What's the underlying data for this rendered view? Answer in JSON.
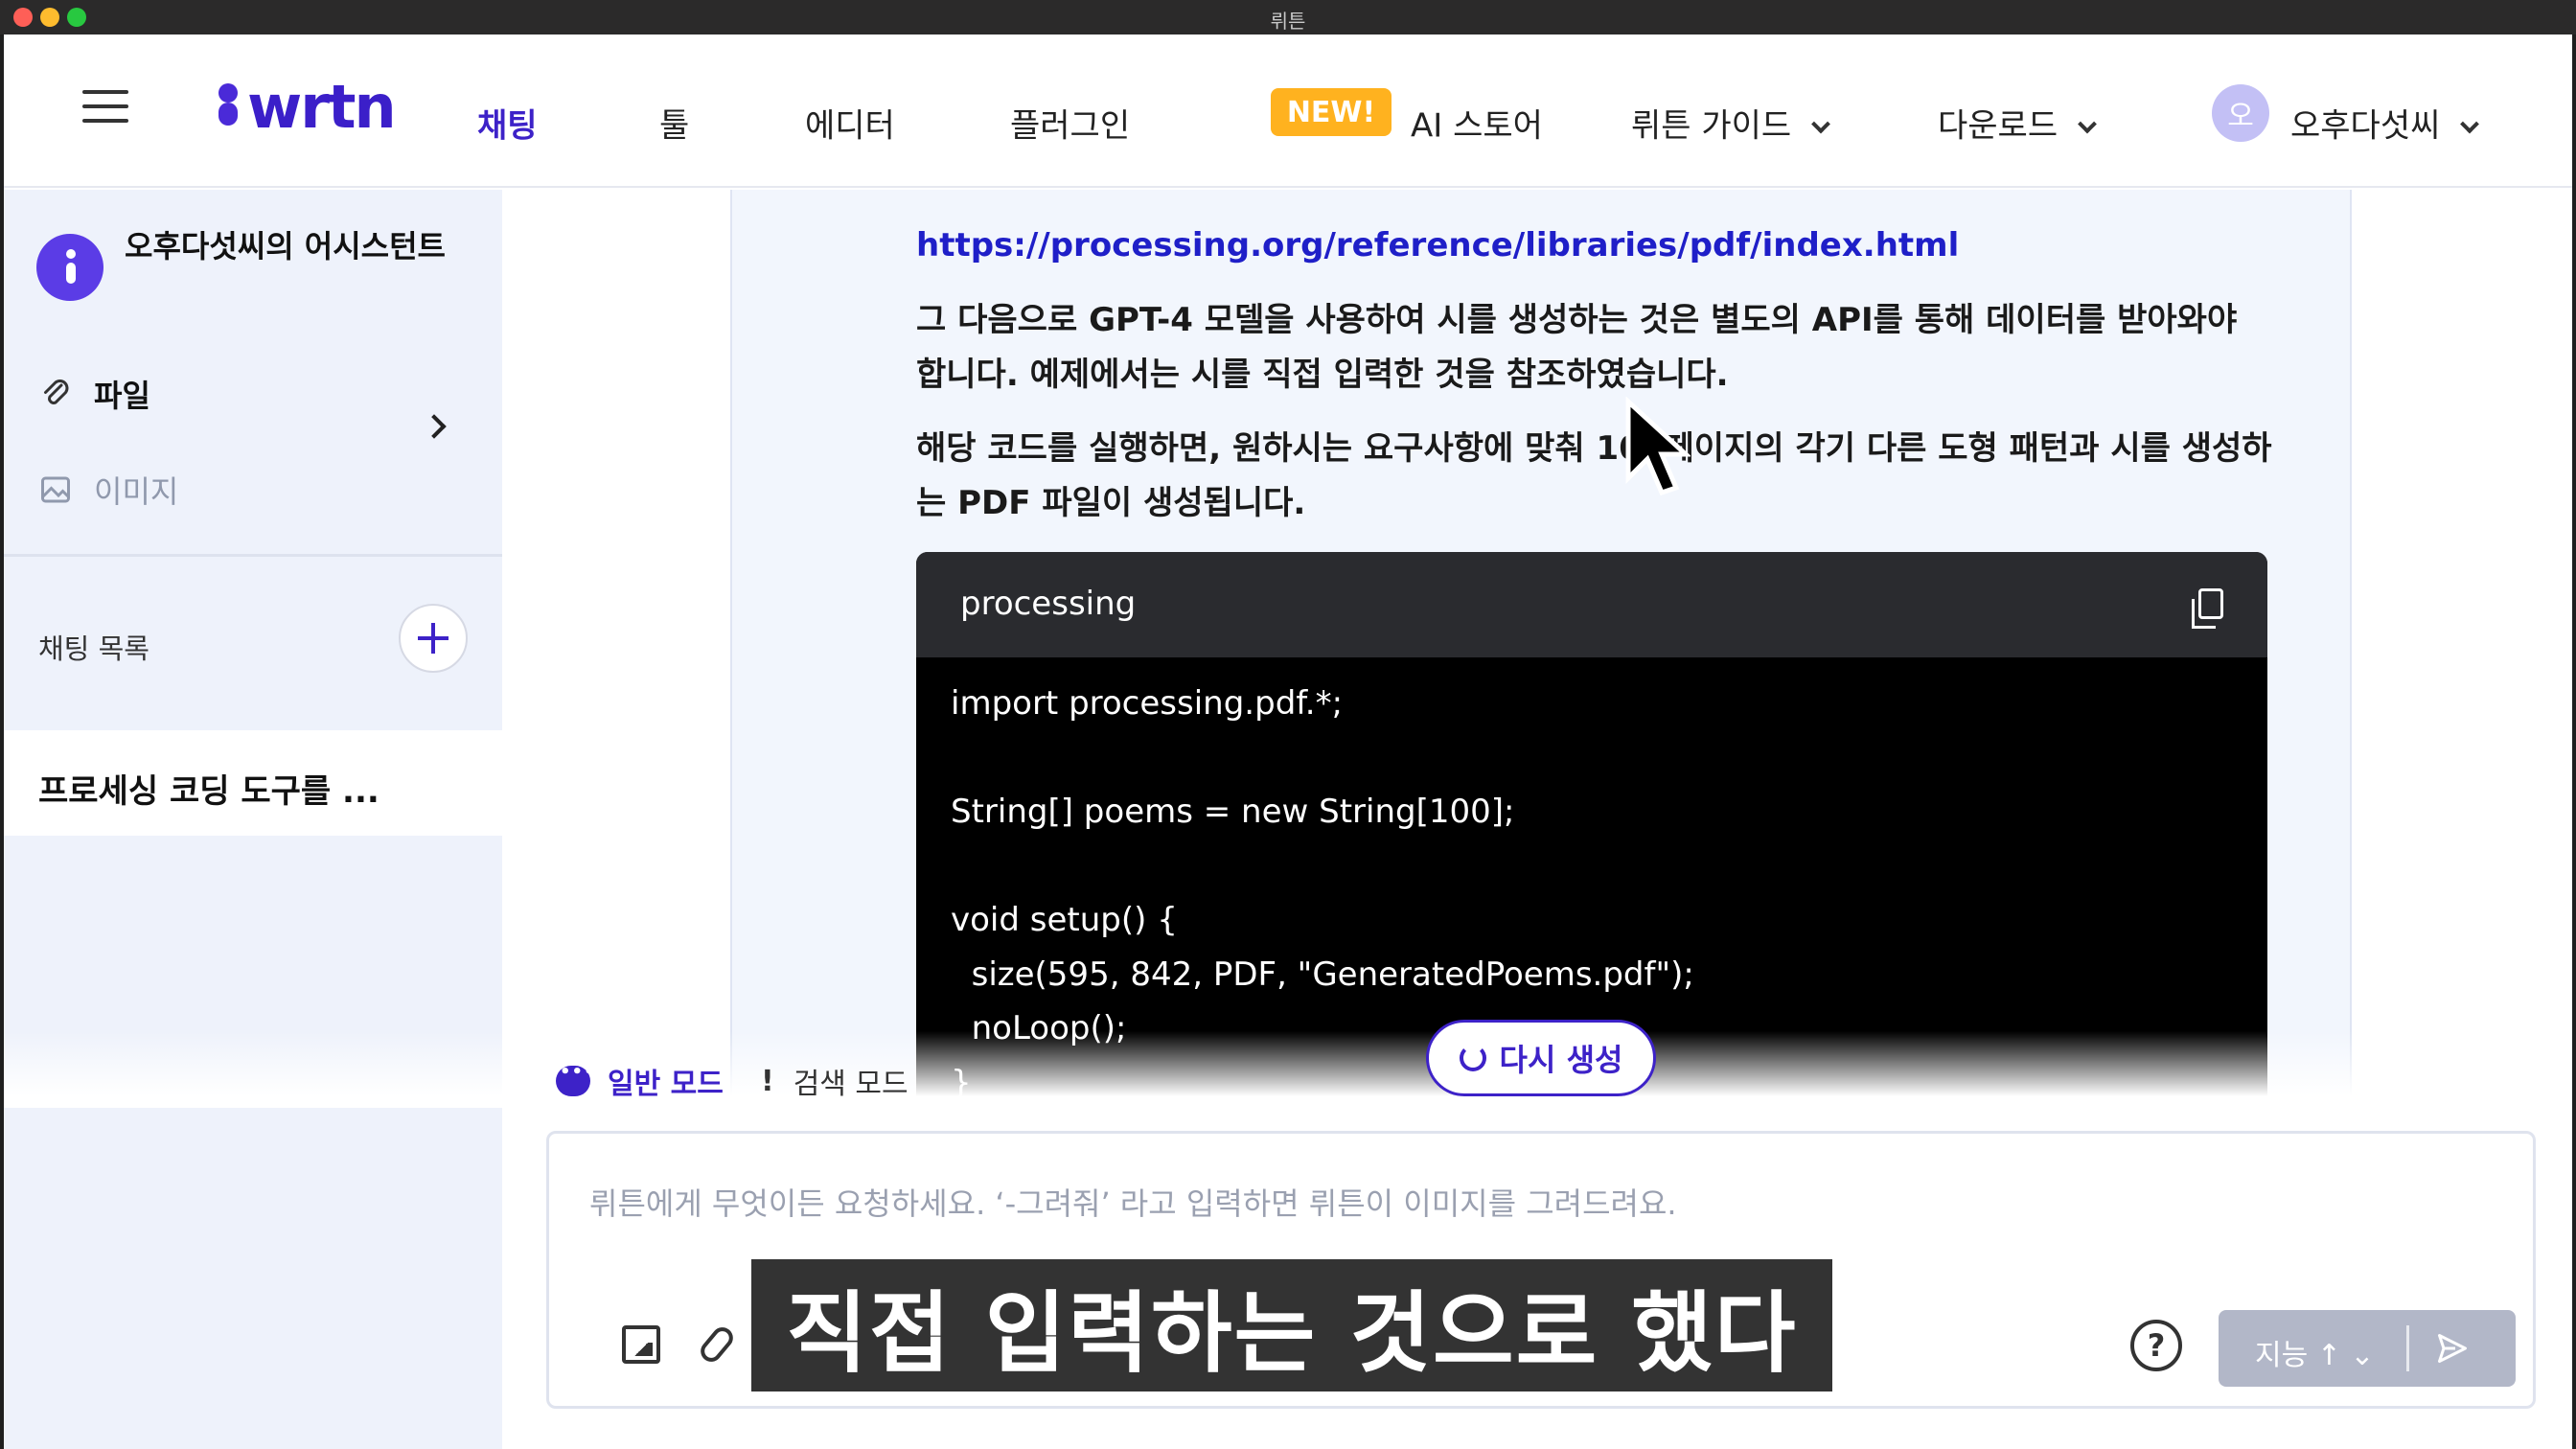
{
  "window": {
    "title": "뤼튼"
  },
  "header": {
    "logo": "wrtn",
    "nav": [
      {
        "label": "채팅",
        "active": true
      },
      {
        "label": "툴"
      },
      {
        "label": "에디터"
      },
      {
        "label": "플러그인"
      },
      {
        "label": "AI 스토어",
        "badge": "NEW!"
      },
      {
        "label": "뤼튼 가이드",
        "dropdown": true
      },
      {
        "label": "다운로드",
        "dropdown": true
      }
    ],
    "user": {
      "avatar_initial": "오",
      "name": "오후다섯씨"
    }
  },
  "sidebar": {
    "assistant_name": "오후다섯씨의 어시스턴트",
    "file_label": "파일",
    "image_label": "이미지",
    "chat_list_title": "채팅 목록",
    "chats": [
      "프로세싱 코딩 도구를 ..."
    ]
  },
  "message": {
    "link": "https://processing.org/reference/libraries/pdf/index.html",
    "para1": "그 다음으로 GPT-4 모델을 사용하여 시를 생성하는 것은 별도의 API를 통해 데이터를 받아와야 합니다. 예제에서는 시를 직접 입력한 것을 참조하였습니다.",
    "para2": "해당 코드를 실행하면, 원하시는 요구사항에 맞춰 100페이지의 각기 다른 도형 패턴과 시를 생성하는 PDF 파일이 생성됩니다.",
    "code": {
      "language": "processing",
      "lines": [
        "import processing.pdf.*;",
        "",
        "String[] poems = new String[100];",
        "",
        "void setup() {",
        "  size(595, 842, PDF, \"GeneratedPoems.pdf\");",
        "  noLoop();",
        "}"
      ]
    }
  },
  "modes": {
    "normal": "일반 모드",
    "search": "검색 모드"
  },
  "regenerate_label": "다시 생성",
  "input": {
    "placeholder": "뤼튼에게 무엇이든 요청하세요.  ‘-그려줘’ 라고 입력하면 뤼튼이 이미지를 그려드려요.",
    "intelligence_label": "지능"
  },
  "subtitle": "직접 입력하는 것으로 했다",
  "colors": {
    "accent": "#3d22c8",
    "badge": "#ffb21f",
    "panel": "#f2f6fd",
    "sidebar": "#eef2fb"
  }
}
